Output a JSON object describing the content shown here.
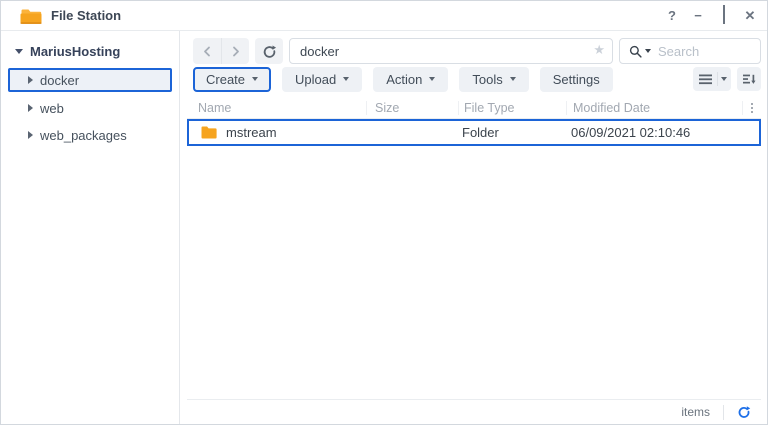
{
  "window": {
    "title": "File Station",
    "controls": {
      "help": "?",
      "minimize": "−",
      "close": "✕"
    }
  },
  "sidebar": {
    "root_label": "MariusHosting",
    "items": [
      {
        "label": "docker",
        "selected": true
      },
      {
        "label": "web",
        "selected": false
      },
      {
        "label": "web_packages",
        "selected": false
      }
    ]
  },
  "toolbar": {
    "path_value": "docker",
    "favorite_star": "★",
    "search_placeholder": "Search",
    "buttons": [
      {
        "label": "Create",
        "dropdown": true,
        "highlighted": true
      },
      {
        "label": "Upload",
        "dropdown": true
      },
      {
        "label": "Action",
        "dropdown": true
      },
      {
        "label": "Tools",
        "dropdown": true
      },
      {
        "label": "Settings",
        "dropdown": false
      }
    ]
  },
  "table": {
    "columns": {
      "name": "Name",
      "size": "Size",
      "file_type": "File Type",
      "modified_date": "Modified Date"
    },
    "rows": [
      {
        "name": "mstream",
        "size": "",
        "file_type": "Folder",
        "modified_date": "06/09/2021 02:10:46",
        "selected": true
      }
    ]
  },
  "statusbar": {
    "items_label": "items"
  },
  "colors": {
    "accent_blue": "#1c64d7",
    "folder_orange": "#f6a41f",
    "refresh_blue": "#1d6fe8"
  }
}
